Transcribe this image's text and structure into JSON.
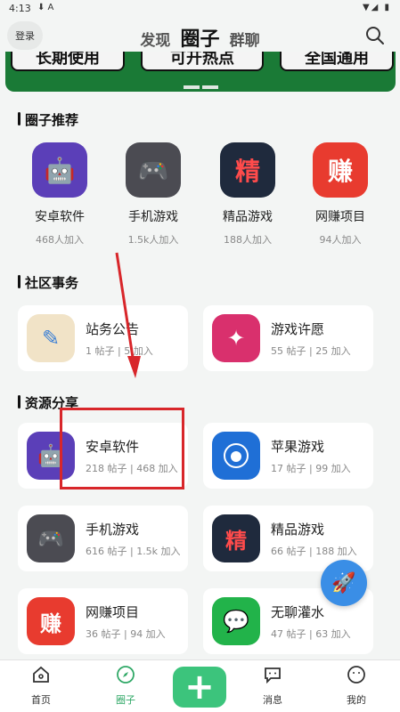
{
  "status": {
    "time": "4:13",
    "notif": "⬇ A",
    "right": "▼◢ ▮"
  },
  "header": {
    "login": "登录",
    "tabs": [
      "发现",
      "圈子",
      "群聊"
    ],
    "active_tab": "圈子"
  },
  "banner": {
    "pills": [
      "长期使用",
      "可开热点",
      "全国通用"
    ]
  },
  "recommend": {
    "title": "圈子推荐",
    "items": [
      {
        "name": "安卓软件",
        "count": "468人加入",
        "color": "#5b3fb8",
        "glyph": "🤖"
      },
      {
        "name": "手机游戏",
        "count": "1.5k人加入",
        "color": "#4b4b52",
        "glyph": "🎮"
      },
      {
        "name": "精品游戏",
        "count": "188人加入",
        "color": "#1f2a3d",
        "glyph": "精"
      },
      {
        "name": "网赚项目",
        "count": "94人加入",
        "color": "#e83b2f",
        "glyph": "赚"
      }
    ]
  },
  "community": {
    "title": "社区事务",
    "cards": [
      {
        "name": "站务公告",
        "meta": "1 帖子 | 5 加入",
        "color": "#f1e3c7",
        "glyph": "✎"
      },
      {
        "name": "游戏许愿",
        "meta": "55 帖子 | 25 加入",
        "color": "#d9306d",
        "glyph": "✦"
      }
    ]
  },
  "resources": {
    "title": "资源分享",
    "cards": [
      {
        "name": "安卓软件",
        "meta": "218 帖子 | 468 加入",
        "color": "#5b3fb8",
        "glyph": "🤖"
      },
      {
        "name": "苹果游戏",
        "meta": "17 帖子 | 99 加入",
        "color": "#1f6fd6",
        "glyph": ""
      },
      {
        "name": "手机游戏",
        "meta": "616 帖子 | 1.5k 加入",
        "color": "#4b4b52",
        "glyph": "🎮"
      },
      {
        "name": "精品游戏",
        "meta": "66 帖子 | 188 加入",
        "color": "#1f2a3d",
        "glyph": "精"
      },
      {
        "name": "网赚项目",
        "meta": "36 帖子 | 94 加入",
        "color": "#e83b2f",
        "glyph": "赚"
      },
      {
        "name": "无聊灌水",
        "meta": "47 帖子 | 63 加入",
        "color": "#22b34a",
        "glyph": "💬"
      }
    ]
  },
  "fab_glyph": "🚀",
  "bottom_nav": {
    "items": [
      "首页",
      "圈子",
      "消息",
      "我的"
    ],
    "active": "圈子",
    "plus": "+"
  }
}
